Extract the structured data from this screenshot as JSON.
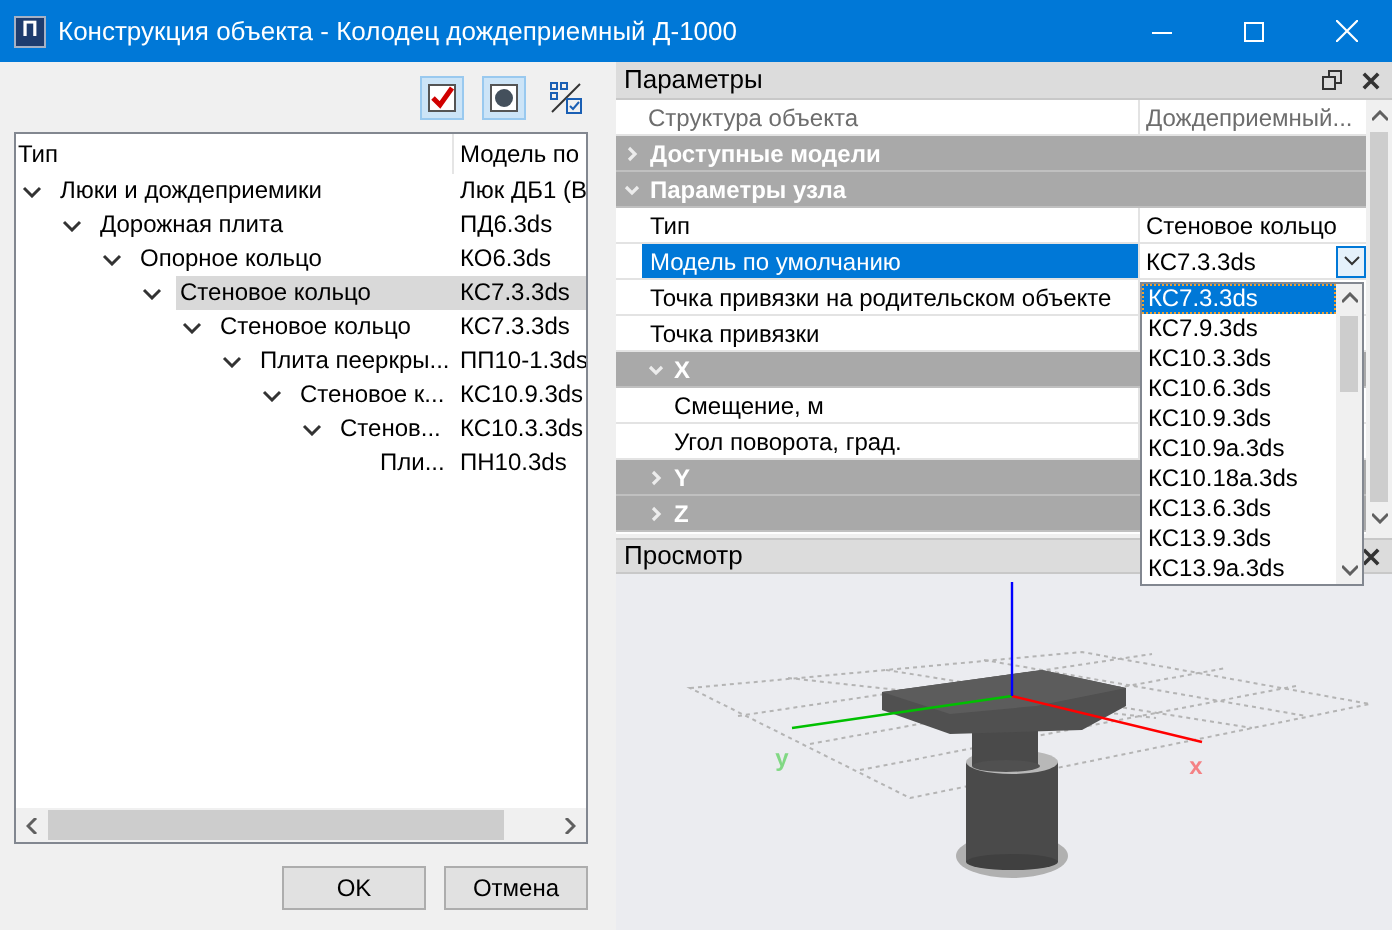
{
  "window": {
    "icon_text": "П",
    "title": "Конструкция объекта - Колодец дождеприемный Д-1000"
  },
  "toolbar": [
    {
      "kind": "check",
      "pressed": true
    },
    {
      "kind": "sphere",
      "pressed": true
    },
    {
      "kind": "list-check",
      "pressed": false
    }
  ],
  "tree": {
    "columns": [
      "Тип",
      "Модель по"
    ],
    "items": [
      {
        "label": "Люки и дождеприемики",
        "model": "Люк ДБ1 (В",
        "expanded": true,
        "selected": false,
        "children": [
          {
            "label": "Дорожная плита",
            "model": "ПД6.3ds",
            "expanded": true,
            "selected": false,
            "children": [
              {
                "label": "Опорное кольцо",
                "model": "КО6.3ds",
                "expanded": true,
                "selected": false,
                "children": [
                  {
                    "label": "Стеновое кольцо",
                    "model": "КС7.3.3ds",
                    "expanded": true,
                    "selected": true,
                    "children": [
                      {
                        "label": "Стеновое кольцо",
                        "model": "КС7.3.3ds",
                        "expanded": true,
                        "selected": false,
                        "children": [
                          {
                            "label": "Плита пееркры...",
                            "model": "ПП10-1.3ds",
                            "expanded": true,
                            "selected": false,
                            "children": [
                              {
                                "label": "Стеновое к...",
                                "model": "КС10.9.3ds",
                                "expanded": true,
                                "selected": false,
                                "children": [
                                  {
                                    "label": "Стенов...",
                                    "model": "КС10.3.3ds",
                                    "expanded": true,
                                    "selected": false,
                                    "children": [
                                      {
                                        "label": "Пли...",
                                        "model": "ПН10.3ds",
                                        "selected": false
                                      }
                                    ]
                                  }
                                ]
                              }
                            ]
                          }
                        ]
                      }
                    ]
                  }
                ]
              }
            ]
          }
        ]
      }
    ]
  },
  "buttons": [
    "OK",
    "Отмена"
  ],
  "parameters": {
    "title": "Параметры",
    "header": {
      "label": "Структура объекта",
      "value": "Дождеприемный..."
    },
    "rows": [
      {
        "kind": "category",
        "label": "Доступные модели",
        "expanded": false
      },
      {
        "kind": "category",
        "label": "Параметры узла",
        "expanded": true,
        "children": [
          {
            "kind": "property",
            "label": "Тип",
            "value": "Стеновое кольцо",
            "selected": false
          },
          {
            "kind": "property",
            "label": "Модель по умолчанию",
            "value": "КС7.3.3ds",
            "selected": true
          },
          {
            "kind": "property",
            "label": "Точка привязки на родительском объекте",
            "selected": false
          },
          {
            "kind": "property",
            "label": "Точка привязки",
            "selected": false
          },
          {
            "kind": "category",
            "label": "X",
            "expanded": true,
            "children": [
              {
                "kind": "property",
                "label": "Смещение, м",
                "selected": false
              },
              {
                "kind": "property",
                "label": "Угол поворота, град.",
                "selected": false
              }
            ]
          },
          {
            "kind": "category",
            "label": "Y",
            "expanded": false
          },
          {
            "kind": "category",
            "label": "Z",
            "expanded": false
          }
        ]
      }
    ],
    "dropdown": {
      "options": [
        {
          "label": "КС7.3.3ds",
          "selected": true
        },
        {
          "label": "КС7.9.3ds",
          "selected": false
        },
        {
          "label": "КС10.3.3ds",
          "selected": false
        },
        {
          "label": "КС10.6.3ds",
          "selected": false
        },
        {
          "label": "КС10.9.3ds",
          "selected": false
        },
        {
          "label": "КС10.9а.3ds",
          "selected": false
        },
        {
          "label": "КС10.18а.3ds",
          "selected": false
        },
        {
          "label": "КС13.6.3ds",
          "selected": false
        },
        {
          "label": "КС13.9.3ds",
          "selected": false
        },
        {
          "label": "КС13.9а.3ds",
          "selected": false
        }
      ]
    }
  },
  "preview": {
    "title": "Просмотр",
    "axes": [
      {
        "label": "y",
        "color": "#00c000"
      },
      {
        "label": "x",
        "color": "#ff0000"
      }
    ]
  }
}
